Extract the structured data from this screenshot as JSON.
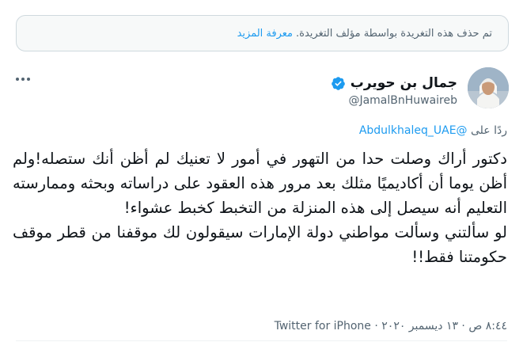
{
  "notice": {
    "text": "تم حذف هذه التغريدة بواسطة مؤلف التغريدة.",
    "learn_more": "معرفة المزيد"
  },
  "author": {
    "display_name": "جمال بن حويرب",
    "handle": "@JamalBnHuwaireb",
    "verified": true
  },
  "reply": {
    "prefix": "ردًا على",
    "mention": "@Abdulkhaleq_UAE"
  },
  "tweet": {
    "paragraph_1": "دكتور أراك وصلت حدا من التهور في أمور لا تعنيك لم أظن أنك ستصله!ولم أظن يوما أن أكاديميًا مثلك بعد مرور هذه العقود على دراساته وبحثه وممارسته التعليم أنه سيصل إلى هذه المنزلة من التخبط كخبط عشواء!",
    "paragraph_2": "لو سألتني وسألت مواطني دولة الإمارات سيقولون لك موقفنا من قطر موقف حكومتنا فقط!!"
  },
  "meta": {
    "timestamp": "٨:٤٤ ص · ١٣ ديسمبر ٢٠٢٠",
    "separator": " · ",
    "source": "Twitter for iPhone"
  },
  "colors": {
    "accent": "#1d9bf0",
    "secondary_text": "#536471",
    "border": "#cfd9de"
  }
}
